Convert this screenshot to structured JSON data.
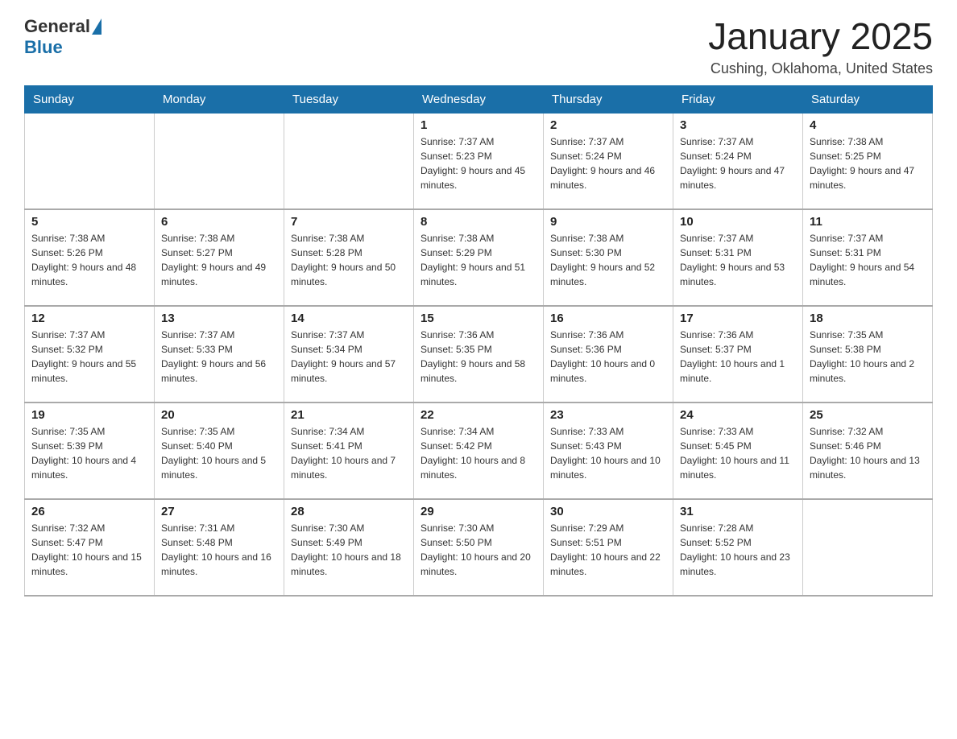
{
  "logo": {
    "general": "General",
    "blue": "Blue"
  },
  "title": "January 2025",
  "subtitle": "Cushing, Oklahoma, United States",
  "days_of_week": [
    "Sunday",
    "Monday",
    "Tuesday",
    "Wednesday",
    "Thursday",
    "Friday",
    "Saturday"
  ],
  "weeks": [
    [
      {
        "day": "",
        "info": ""
      },
      {
        "day": "",
        "info": ""
      },
      {
        "day": "",
        "info": ""
      },
      {
        "day": "1",
        "info": "Sunrise: 7:37 AM\nSunset: 5:23 PM\nDaylight: 9 hours and 45 minutes."
      },
      {
        "day": "2",
        "info": "Sunrise: 7:37 AM\nSunset: 5:24 PM\nDaylight: 9 hours and 46 minutes."
      },
      {
        "day": "3",
        "info": "Sunrise: 7:37 AM\nSunset: 5:24 PM\nDaylight: 9 hours and 47 minutes."
      },
      {
        "day": "4",
        "info": "Sunrise: 7:38 AM\nSunset: 5:25 PM\nDaylight: 9 hours and 47 minutes."
      }
    ],
    [
      {
        "day": "5",
        "info": "Sunrise: 7:38 AM\nSunset: 5:26 PM\nDaylight: 9 hours and 48 minutes."
      },
      {
        "day": "6",
        "info": "Sunrise: 7:38 AM\nSunset: 5:27 PM\nDaylight: 9 hours and 49 minutes."
      },
      {
        "day": "7",
        "info": "Sunrise: 7:38 AM\nSunset: 5:28 PM\nDaylight: 9 hours and 50 minutes."
      },
      {
        "day": "8",
        "info": "Sunrise: 7:38 AM\nSunset: 5:29 PM\nDaylight: 9 hours and 51 minutes."
      },
      {
        "day": "9",
        "info": "Sunrise: 7:38 AM\nSunset: 5:30 PM\nDaylight: 9 hours and 52 minutes."
      },
      {
        "day": "10",
        "info": "Sunrise: 7:37 AM\nSunset: 5:31 PM\nDaylight: 9 hours and 53 minutes."
      },
      {
        "day": "11",
        "info": "Sunrise: 7:37 AM\nSunset: 5:31 PM\nDaylight: 9 hours and 54 minutes."
      }
    ],
    [
      {
        "day": "12",
        "info": "Sunrise: 7:37 AM\nSunset: 5:32 PM\nDaylight: 9 hours and 55 minutes."
      },
      {
        "day": "13",
        "info": "Sunrise: 7:37 AM\nSunset: 5:33 PM\nDaylight: 9 hours and 56 minutes."
      },
      {
        "day": "14",
        "info": "Sunrise: 7:37 AM\nSunset: 5:34 PM\nDaylight: 9 hours and 57 minutes."
      },
      {
        "day": "15",
        "info": "Sunrise: 7:36 AM\nSunset: 5:35 PM\nDaylight: 9 hours and 58 minutes."
      },
      {
        "day": "16",
        "info": "Sunrise: 7:36 AM\nSunset: 5:36 PM\nDaylight: 10 hours and 0 minutes."
      },
      {
        "day": "17",
        "info": "Sunrise: 7:36 AM\nSunset: 5:37 PM\nDaylight: 10 hours and 1 minute."
      },
      {
        "day": "18",
        "info": "Sunrise: 7:35 AM\nSunset: 5:38 PM\nDaylight: 10 hours and 2 minutes."
      }
    ],
    [
      {
        "day": "19",
        "info": "Sunrise: 7:35 AM\nSunset: 5:39 PM\nDaylight: 10 hours and 4 minutes."
      },
      {
        "day": "20",
        "info": "Sunrise: 7:35 AM\nSunset: 5:40 PM\nDaylight: 10 hours and 5 minutes."
      },
      {
        "day": "21",
        "info": "Sunrise: 7:34 AM\nSunset: 5:41 PM\nDaylight: 10 hours and 7 minutes."
      },
      {
        "day": "22",
        "info": "Sunrise: 7:34 AM\nSunset: 5:42 PM\nDaylight: 10 hours and 8 minutes."
      },
      {
        "day": "23",
        "info": "Sunrise: 7:33 AM\nSunset: 5:43 PM\nDaylight: 10 hours and 10 minutes."
      },
      {
        "day": "24",
        "info": "Sunrise: 7:33 AM\nSunset: 5:45 PM\nDaylight: 10 hours and 11 minutes."
      },
      {
        "day": "25",
        "info": "Sunrise: 7:32 AM\nSunset: 5:46 PM\nDaylight: 10 hours and 13 minutes."
      }
    ],
    [
      {
        "day": "26",
        "info": "Sunrise: 7:32 AM\nSunset: 5:47 PM\nDaylight: 10 hours and 15 minutes."
      },
      {
        "day": "27",
        "info": "Sunrise: 7:31 AM\nSunset: 5:48 PM\nDaylight: 10 hours and 16 minutes."
      },
      {
        "day": "28",
        "info": "Sunrise: 7:30 AM\nSunset: 5:49 PM\nDaylight: 10 hours and 18 minutes."
      },
      {
        "day": "29",
        "info": "Sunrise: 7:30 AM\nSunset: 5:50 PM\nDaylight: 10 hours and 20 minutes."
      },
      {
        "day": "30",
        "info": "Sunrise: 7:29 AM\nSunset: 5:51 PM\nDaylight: 10 hours and 22 minutes."
      },
      {
        "day": "31",
        "info": "Sunrise: 7:28 AM\nSunset: 5:52 PM\nDaylight: 10 hours and 23 minutes."
      },
      {
        "day": "",
        "info": ""
      }
    ]
  ]
}
